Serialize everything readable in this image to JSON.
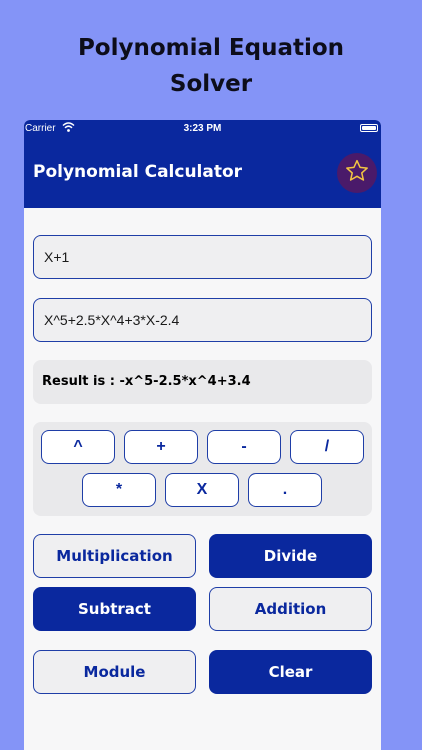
{
  "promo": {
    "line1": "Polynomial Equation",
    "line2": "Solver"
  },
  "status_bar": {
    "carrier": "Carrier",
    "time": "3:23 PM"
  },
  "app_bar": {
    "title": "Polynomial Calculator",
    "favorite_icon": "star-icon"
  },
  "inputs": {
    "first_polynomial": "X+1",
    "second_polynomial": "X^5+2.5*X^4+3*X-2.4"
  },
  "result": {
    "text": "Result is : -x^5-2.5*x^4+3.4"
  },
  "operators": {
    "power": "^",
    "plus": "+",
    "minus": "-",
    "slash": "/",
    "asterisk": "*",
    "x": "X",
    "dot": "."
  },
  "actions": {
    "multiplication": "Multiplication",
    "divide": "Divide",
    "subtract": "Subtract",
    "addition": "Addition",
    "module": "Module",
    "clear": "Clear"
  },
  "colors": {
    "background": "#8494f7",
    "primary": "#0a289e",
    "favorite_button": "#4a1a6a",
    "star": "#f4c542"
  }
}
